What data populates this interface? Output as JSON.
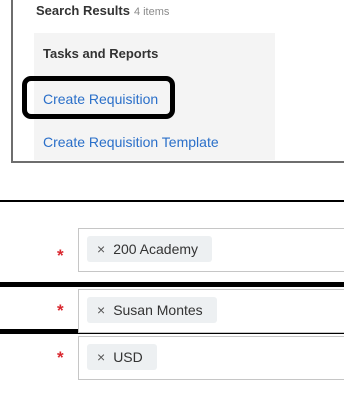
{
  "search_results": {
    "title": "Search Results",
    "count": "4 items",
    "section_title": "Tasks and Reports",
    "links": [
      {
        "label": "Create Requisition"
      },
      {
        "label": "Create Requisition Template"
      }
    ]
  },
  "form": {
    "fields": [
      {
        "required_mark": "*",
        "remove_glyph": "×",
        "value": "200 Academy"
      },
      {
        "required_mark": "*",
        "remove_glyph": "×",
        "value": "Susan Montes"
      },
      {
        "required_mark": "*",
        "remove_glyph": "×",
        "value": "USD"
      }
    ]
  },
  "colors": {
    "link": "#2a6fc9",
    "required": "#d9272e",
    "highlight": "#000000"
  }
}
